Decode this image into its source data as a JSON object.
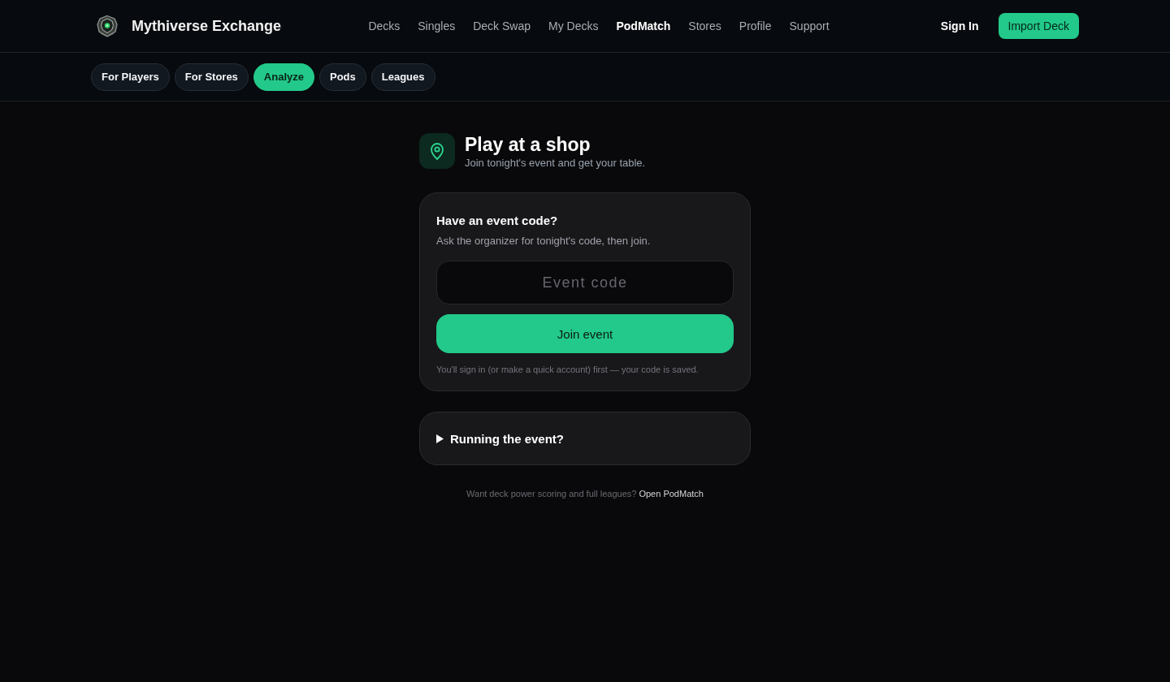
{
  "header": {
    "brand": "Mythiverse Exchange",
    "nav": [
      {
        "label": "Decks",
        "selected": false
      },
      {
        "label": "Singles",
        "selected": false
      },
      {
        "label": "Deck Swap",
        "selected": false
      },
      {
        "label": "My Decks",
        "selected": false
      },
      {
        "label": "PodMatch",
        "selected": true
      },
      {
        "label": "Stores",
        "selected": false
      },
      {
        "label": "Profile",
        "selected": false
      },
      {
        "label": "Support",
        "selected": false
      }
    ],
    "sign_in": "Sign In",
    "import_button": "Import Deck"
  },
  "subnav": {
    "tabs": [
      {
        "label": "For Players",
        "selected": false
      },
      {
        "label": "For Stores",
        "selected": false
      },
      {
        "label": "Analyze",
        "selected": true
      },
      {
        "label": "Pods",
        "selected": false
      },
      {
        "label": "Leagues",
        "selected": false
      }
    ]
  },
  "intro": {
    "title": "Play at a shop",
    "subtitle": "Join tonight's event and get your table."
  },
  "event_card": {
    "title": "Have an event code?",
    "description": "Ask the organizer for tonight's code, then join.",
    "code_field": {
      "placeholder": "Event code"
    },
    "join_button": "Join event",
    "note": "You'll sign in (or make a quick account) first — your code is saved."
  },
  "running_panel": {
    "label": "Running the event?",
    "expanded": false
  },
  "footer": {
    "text": "Want deck power scoring and full leagues?",
    "link": "Open PodMatch"
  }
}
